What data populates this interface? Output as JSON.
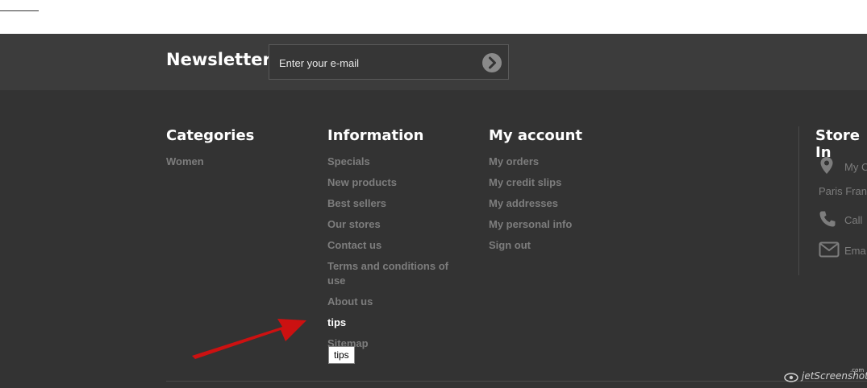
{
  "newsletter": {
    "title": "Newsletter",
    "placeholder": "Enter your e-mail"
  },
  "categories": {
    "title": "Categories",
    "items": [
      "Women"
    ]
  },
  "information": {
    "title": "Information",
    "items": [
      "Specials",
      "New products",
      "Best sellers",
      "Our stores",
      "Contact us",
      "Terms and conditions of use",
      "About us",
      "tips",
      "Sitemap"
    ]
  },
  "my_account": {
    "title": "My account",
    "items": [
      "My orders",
      "My credit slips",
      "My addresses",
      "My personal info",
      "Sign out"
    ]
  },
  "store_info": {
    "title": "Store In",
    "address_line1": "My C",
    "address_line2": "Paris Fran",
    "phone": "Call",
    "email": "Ema"
  },
  "tooltip": {
    "text": "tips"
  },
  "watermark": {
    "text": "jetScreenshot",
    "suffix": ".com"
  },
  "colors": {
    "newsletter_band": "#3c3c3c",
    "footer_bg": "#333333",
    "link": "#7d7d7d",
    "active_link": "#ffffff",
    "arrow": "#cc1111"
  }
}
